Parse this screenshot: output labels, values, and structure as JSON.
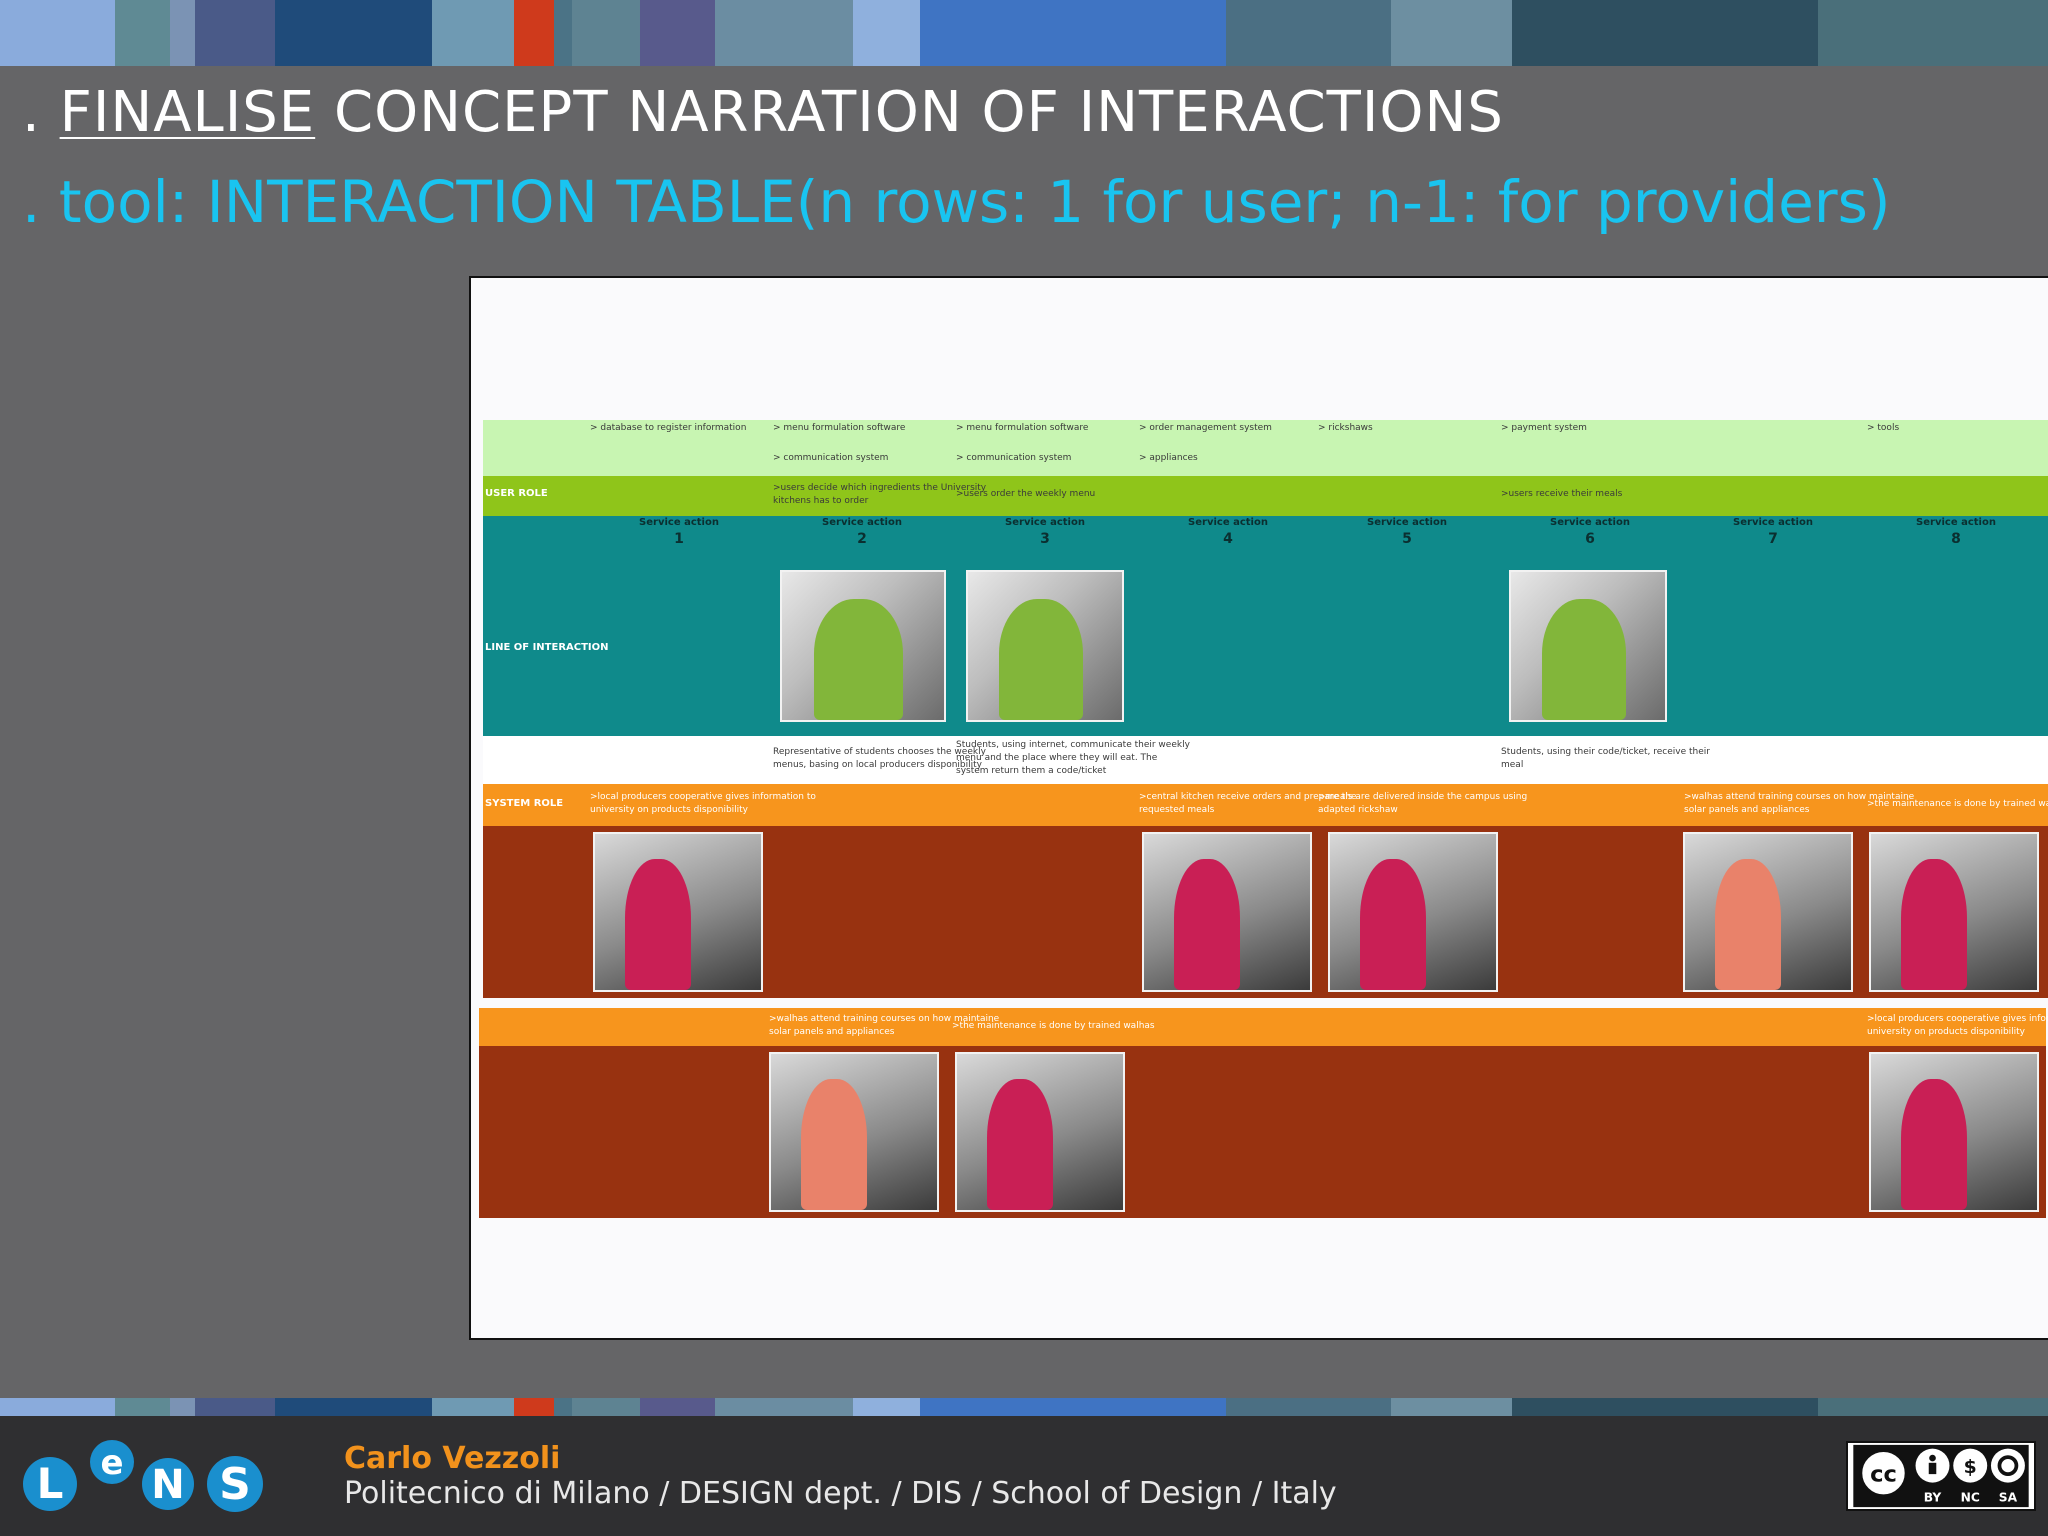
{
  "slide": {
    "title_prefix": ". ",
    "title_underlined": "FINALISE",
    "title_rest": " CONCEPT NARRATION OF INTERACTIONS",
    "subtitle": ". tool: INTERACTION TABLE(n rows: 1 for user; n-1: for providers)"
  },
  "colors": {
    "background": "#656567",
    "title": "#ffffff",
    "subtitle": "#19c4f0",
    "author": "#f2921c",
    "bar_blocks": [
      "#8aabdc",
      "#5f8a94",
      "#7b93b4",
      "#4a5a88",
      "#1f4b7a",
      "#6f9ab3",
      "#cf3a1c",
      "#4b7386",
      "#585a8c",
      "#5e8392",
      "#8fb0dd",
      "#3f74c3",
      "#4b6f83",
      "#6d8fa1",
      "#2e4f60",
      "#4a6f7a"
    ]
  },
  "table": {
    "tools": [
      {
        "l1": "> database to register information",
        "l2": ""
      },
      {
        "l1": "> menu formulation software",
        "l2": "> communication system"
      },
      {
        "l1": "> menu formulation software",
        "l2": "> communication system"
      },
      {
        "l1": "> order management system",
        "l2": "> appliances"
      },
      {
        "l1": "> rickshaws",
        "l2": ""
      },
      {
        "l1": "> payment system",
        "l2": ""
      },
      {
        "l1": "",
        "l2": ""
      },
      {
        "l1": "> tools",
        "l2": ""
      }
    ],
    "user_role_label": "USER ROLE",
    "user_role_texts": [
      {
        "l1": ">users decide which ingredients the University",
        "l2": "kitchens has to order"
      },
      {
        "l1": ">users order the weekly menu",
        "l2": ""
      },
      {
        "l1": ">users receive their meals",
        "l2": ""
      }
    ],
    "service_action_label": "Service action",
    "service_numbers": [
      "1",
      "2",
      "3",
      "4",
      "5",
      "6",
      "7",
      "8"
    ],
    "line_of_interaction_label": "LINE OF INTERACTION",
    "descriptions": [
      {
        "l1": "Representative of students chooses the weekly",
        "l2": "menus, basing on local producers disponibility",
        "l3": ""
      },
      {
        "l1": "Students, using internet, communicate their weekly",
        "l2": "menu and the place where they will eat. The",
        "l3": "system return them a code/ticket"
      },
      {
        "l1": "Students, using their code/ticket, receive their",
        "l2": "meal",
        "l3": ""
      }
    ],
    "system_role_label": "SYSTEM ROLE",
    "system_role_texts": [
      {
        "l1": ">local producers cooperative gives information to",
        "l2": "university on products disponibility"
      },
      {
        "l1": ">central kitchen receive orders and prepare the",
        "l2": "requested meals"
      },
      {
        "l1": ">meals are delivered inside the campus using",
        "l2": "adapted rickshaw"
      },
      {
        "l1": ">walhas attend training courses on how maintaine",
        "l2": "solar panels and appliances"
      },
      {
        "l1": ">the maintenance is done by trained walhas",
        "l2": ""
      }
    ],
    "second_row_texts": [
      {
        "l1": ">walhas attend training courses on how maintaine",
        "l2": "solar panels and appliances"
      },
      {
        "l1": ">the maintenance is done by trained walhas",
        "l2": ""
      },
      {
        "l1": ">local producers cooperative gives information to",
        "l2": "university on products disponibility"
      }
    ]
  },
  "footer": {
    "author": "Carlo Vezzoli",
    "affiliation": "Politecnico di Milano / DESIGN dept. / DIS / School of Design / Italy",
    "logo_letters": [
      "L",
      "e",
      "N",
      "S"
    ],
    "cc_labels": [
      "BY",
      "NC",
      "SA"
    ],
    "cc_badge": "cc"
  }
}
